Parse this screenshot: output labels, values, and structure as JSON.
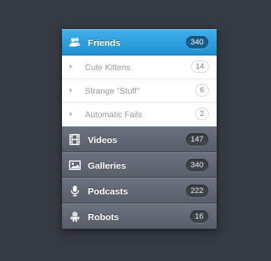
{
  "menu": {
    "friends": {
      "label": "Friends",
      "count": "340",
      "icon": "users-icon"
    },
    "sub_items": [
      {
        "label": "Cute Kittens",
        "count": "14"
      },
      {
        "label": "Strange \"Stuff\"",
        "count": "6"
      },
      {
        "label": "Automatic Fails",
        "count": "2"
      }
    ],
    "videos": {
      "label": "Videos",
      "count": "147",
      "icon": "film-icon"
    },
    "galleries": {
      "label": "Galleries",
      "count": "340",
      "icon": "image-icon"
    },
    "podcasts": {
      "label": "Podcasts",
      "count": "222",
      "icon": "microphone-icon"
    },
    "robots": {
      "label": "Robots",
      "count": "16",
      "icon": "robot-icon"
    }
  },
  "colors": {
    "background": "#353a41",
    "active_blue": "#2a9fdf",
    "row_gray": "#616772",
    "submenu_white": "#ffffff"
  }
}
